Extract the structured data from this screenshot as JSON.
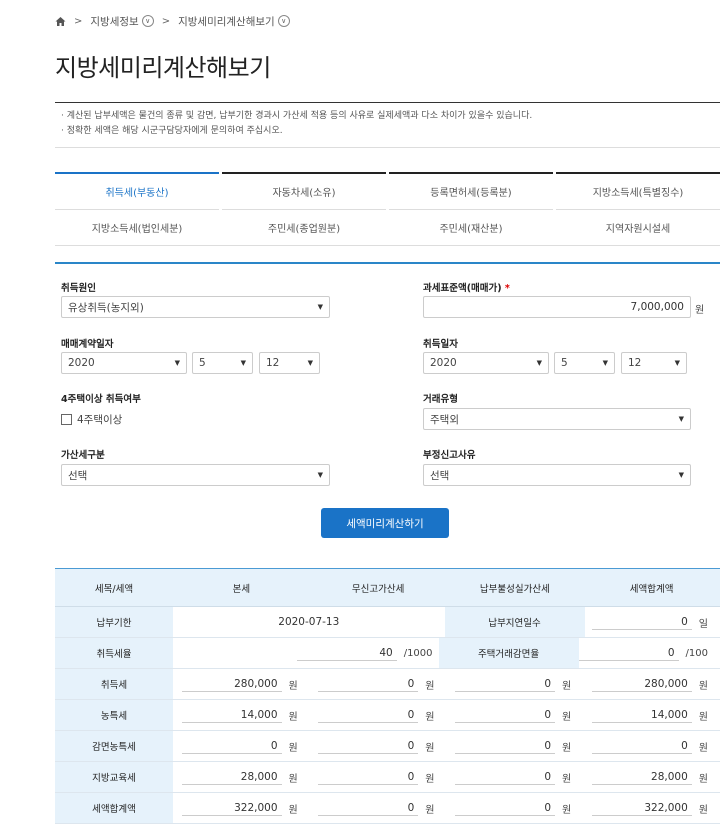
{
  "breadcrumb": {
    "item1": "지방세정보",
    "item2": "지방세미리계산해보기"
  },
  "page_title": "지방세미리계산해보기",
  "notice": [
    "· 계산된 납부세액은 물건의 종류 및 감면, 납부기한 경과시 가산세 적용 등의 사유로 실제세액과 다소 차이가 있을수 있습니다.",
    "· 정확한 세액은 해당 시군구담당자에게 문의하여 주십시오."
  ],
  "tabs_row1": [
    "취득세(부동산)",
    "자동차세(소유)",
    "등록면허세(등록분)",
    "지방소득세(특별징수)"
  ],
  "tabs_row2": [
    "지방소득세(법인세분)",
    "주민세(종업원분)",
    "주민세(재산분)",
    "지역자원시설세"
  ],
  "form": {
    "acq_cause_label": "취득원인",
    "acq_cause_value": "유상취득(농지외)",
    "tax_base_label": "과세표준액(매매가)",
    "required_mark": "*",
    "tax_base_value": "7,000,000",
    "won": "원",
    "contract_date_label": "매매계약일자",
    "contract_year": "2020",
    "contract_month": "5",
    "contract_day": "12",
    "acq_date_label": "취득일자",
    "acq_year": "2020",
    "acq_month": "5",
    "acq_day": "12",
    "house4_label": "4주택이상 취득여부",
    "house4_check": "4주택이상",
    "trade_type_label": "거래유형",
    "trade_type_value": "주택외",
    "addtax_label": "가산세구분",
    "addtax_value": "선택",
    "unfair_label": "부정신고사유",
    "unfair_value": "선택",
    "calc_button": "세액미리계산하기"
  },
  "table": {
    "headers": [
      "세목/세액",
      "본세",
      "무신고가산세",
      "납부불성실가산세",
      "세액합계액"
    ],
    "due_label": "납부기한",
    "due_value": "2020-07-13",
    "late_days_label": "납부지연일수",
    "late_days_value": "0",
    "late_days_unit": "일",
    "rate_label": "취득세율",
    "rate_value": "40",
    "rate_unit": "/1000",
    "reduce_label": "주택거래감면율",
    "reduce_value": "0",
    "reduce_unit": "/100",
    "unit": "원",
    "rows": [
      {
        "label": "취득세",
        "v": [
          "280,000",
          "0",
          "0",
          "280,000"
        ]
      },
      {
        "label": "농특세",
        "v": [
          "14,000",
          "0",
          "0",
          "14,000"
        ]
      },
      {
        "label": "감면농특세",
        "v": [
          "0",
          "0",
          "0",
          "0"
        ]
      },
      {
        "label": "지방교육세",
        "v": [
          "28,000",
          "0",
          "0",
          "28,000"
        ]
      },
      {
        "label": "세액합계액",
        "v": [
          "322,000",
          "0",
          "0",
          "322,000"
        ]
      }
    ]
  }
}
